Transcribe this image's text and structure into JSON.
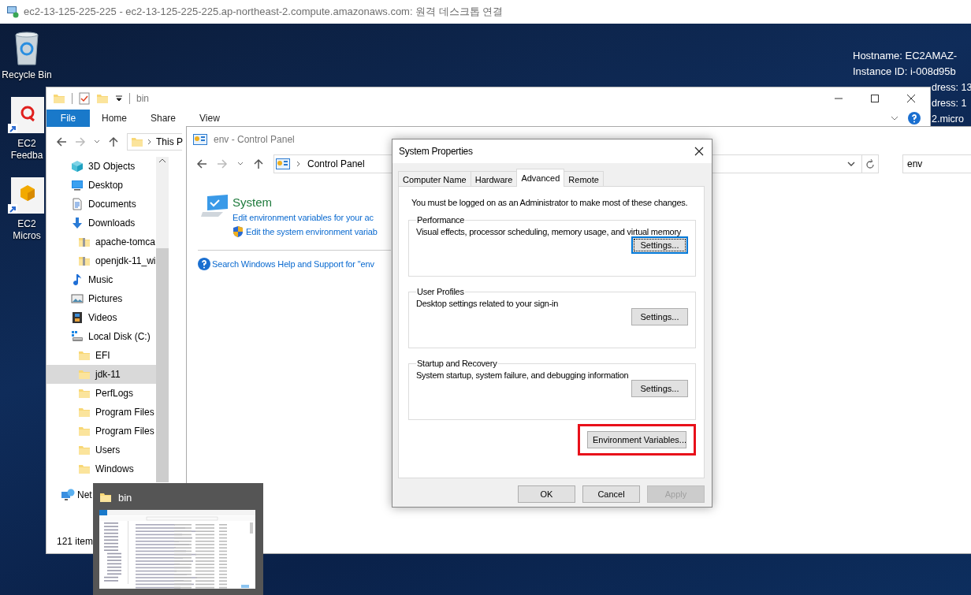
{
  "remote_window": {
    "title": "ec2-13-125-225-225 - ec2-13-125-225-225.ap-northeast-2.compute.amazonaws.com: 원격 데스크톱 연결"
  },
  "desktop": {
    "icons": [
      {
        "kind": "recycle",
        "lines": [
          "Recycle Bin"
        ]
      },
      {
        "kind": "feedback",
        "lines": [
          "EC2",
          "Feedba"
        ]
      },
      {
        "kind": "box",
        "lines": [
          "EC2",
          "Micros"
        ]
      }
    ],
    "info_lines": [
      "Hostname: EC2AMAZ-",
      "Instance ID: i-008d95b"
    ],
    "info_tail_lines": [
      "dress: 13",
      "dress: 1",
      "2.micro"
    ]
  },
  "explorer": {
    "title": "bin",
    "ribbon_tabs": [
      {
        "label": "File",
        "kind": "file"
      },
      {
        "label": "Home",
        "kind": "tab"
      },
      {
        "label": "Share",
        "kind": "tab"
      },
      {
        "label": "View",
        "kind": "tab"
      }
    ],
    "address": "This P",
    "nav_items": [
      {
        "label": "3D Objects",
        "kind": "cube",
        "selected": false
      },
      {
        "label": "Desktop",
        "kind": "desktop",
        "selected": false
      },
      {
        "label": "Documents",
        "kind": "documents",
        "selected": false
      },
      {
        "label": "Downloads",
        "kind": "downloads",
        "selected": false,
        "children": [
          {
            "label": "apache-tomca",
            "kind": "zip",
            "selected": false
          },
          {
            "label": "openjdk-11_wi",
            "kind": "zip",
            "selected": false
          }
        ]
      },
      {
        "label": "Music",
        "kind": "music",
        "selected": false
      },
      {
        "label": "Pictures",
        "kind": "pictures",
        "selected": false
      },
      {
        "label": "Videos",
        "kind": "videos",
        "selected": false
      },
      {
        "label": "Local Disk (C:)",
        "kind": "disk",
        "selected": false,
        "children": [
          {
            "label": "EFI",
            "kind": "folder",
            "selected": false
          },
          {
            "label": "jdk-11",
            "kind": "folder",
            "selected": true
          },
          {
            "label": "PerfLogs",
            "kind": "folder",
            "selected": false
          },
          {
            "label": "Program Files",
            "kind": "folder",
            "selected": false
          },
          {
            "label": "Program Files",
            "kind": "folder",
            "selected": false
          },
          {
            "label": "Users",
            "kind": "folder",
            "selected": false
          },
          {
            "label": "Windows",
            "kind": "folder",
            "selected": false
          }
        ]
      }
    ],
    "network_item": {
      "label": "Net",
      "kind": "network",
      "selected": false
    },
    "status": "121 item"
  },
  "control_panel": {
    "title": "env - Control Panel",
    "breadcrumb": "Control Panel",
    "search": "env",
    "result_title": "System",
    "links": [
      {
        "label": "Edit environment variables for your ac",
        "kind": "plain"
      },
      {
        "label": "Edit the system environment variab",
        "kind": "shield"
      }
    ],
    "help_link": "Search Windows Help and Support for \"env"
  },
  "dialog": {
    "title": "System Properties",
    "tabs": [
      {
        "label": "Computer Name",
        "selected": false
      },
      {
        "label": "Hardware",
        "selected": false
      },
      {
        "label": "Advanced",
        "selected": true
      },
      {
        "label": "Remote",
        "selected": false
      }
    ],
    "notice": "You must be logged on as an Administrator to make most of these changes.",
    "groups": [
      {
        "title": "Performance",
        "description": "Visual effects, processor scheduling, memory usage, and virtual memory",
        "button": "Settings...",
        "focused": true
      },
      {
        "title": "User Profiles",
        "description": "Desktop settings related to your sign-in",
        "button": "Settings...",
        "focused": false
      },
      {
        "title": "Startup and Recovery",
        "description": "System startup, system failure, and debugging information",
        "button": "Settings...",
        "focused": false
      }
    ],
    "env_button": {
      "label": "Environment Variables...",
      "highlighted": true
    },
    "footer_buttons": [
      {
        "label": "OK",
        "disabled": false
      },
      {
        "label": "Cancel",
        "disabled": false
      },
      {
        "label": "Apply",
        "disabled": true
      }
    ]
  },
  "taskbar_preview": {
    "title": "bin"
  }
}
